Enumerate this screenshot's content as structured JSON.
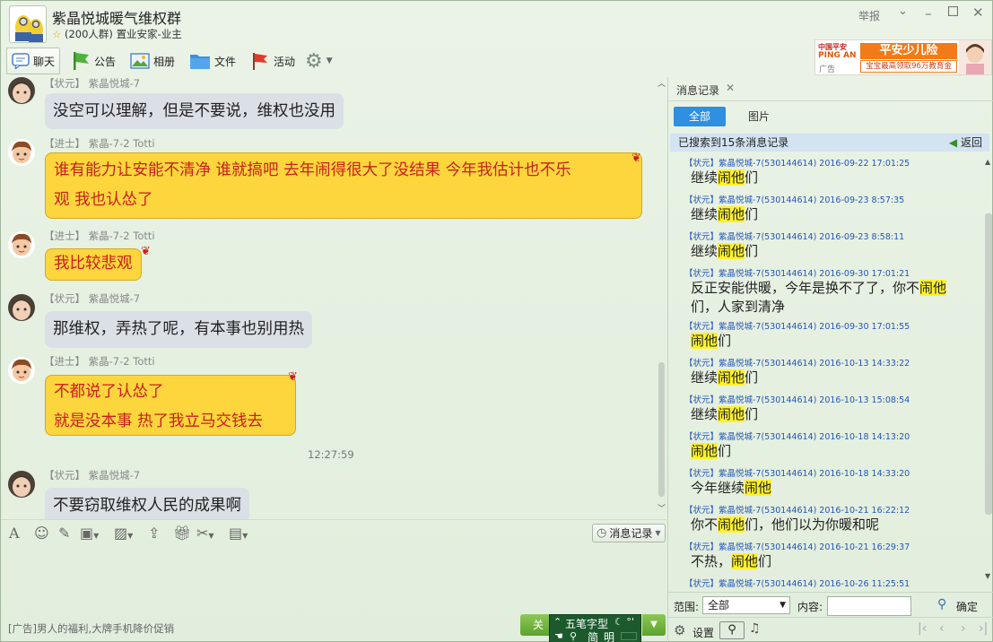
{
  "window": {
    "title": "紫晶悦城暖气维权群",
    "subtitle_count": "(200人群)",
    "subtitle_role": "置业安家-业主",
    "report": "举报"
  },
  "toolbar": {
    "chat": "聊天",
    "notice": "公告",
    "album": "相册",
    "file": "文件",
    "activity": "活动"
  },
  "ad": {
    "brand_cn": "中国平安",
    "brand_en": "PING AN",
    "ad_mark": "广告",
    "headline": "平安少儿险",
    "tagline": "宝宝最高领取96万教育金"
  },
  "messages": [
    {
      "rank": "【状元】",
      "name": "紫晶悦城-7",
      "text": "没空可以理解，但是不要说，维权也没用",
      "style": "gray"
    },
    {
      "rank": "【进士】",
      "name": "紫晶-7-2 Totti",
      "text1": "谁有能力让安能不清净 谁就搞吧  去年闹得很大了没结果 今年我估计也不乐",
      "text2": "观 我也认怂了",
      "style": "yellow"
    },
    {
      "rank": "【进士】",
      "name": "紫晶-7-2 Totti",
      "text": "我比较悲观",
      "style": "yellow"
    },
    {
      "rank": "【状元】",
      "name": "紫晶悦城-7",
      "text": "那维权，弄热了呢，有本事也别用热",
      "style": "gray"
    },
    {
      "rank": "【进士】",
      "name": "紫晶-7-2 Totti",
      "text1": "不都说了认怂了",
      "text2": "就是没本事  热了我立马交钱去",
      "style": "yellow"
    },
    {
      "rank": "【状元】",
      "name": "紫晶悦城-7",
      "text": "不要窃取维权人民的成果啊",
      "style": "gray"
    }
  ],
  "timestamp": "12:27:59",
  "input": {
    "history_label": "消息记录",
    "ad_text": "[广告]男人的福利,大牌手机降价促销",
    "close_label": "关",
    "ime_name": "五笔字型",
    "ime_mode": "简",
    "ime_mode2": "明"
  },
  "history": {
    "tab_label": "消息记录",
    "seg_all": "全部",
    "seg_pictures": "图片",
    "found_text": "已搜索到15条消息记录",
    "back_label": "返回",
    "keyword": "闹他",
    "records": [
      {
        "header": "【状元】紫晶悦城-7(530144614) 2016-09-22 17:01:25",
        "pre": "继续",
        "post": "们"
      },
      {
        "header": "【状元】紫晶悦城-7(530144614) 2016-09-23 8:57:35",
        "pre": "继续",
        "post": "们"
      },
      {
        "header": "【状元】紫晶悦城-7(530144614) 2016-09-23 8:58:11",
        "pre": "继续",
        "post": "们"
      },
      {
        "header": "【状元】紫晶悦城-7(530144614) 2016-09-30 17:01:21",
        "pre": "反正安能供暖，今年是换不了了，你不",
        "post": "们，人家到清净"
      },
      {
        "header": "【状元】紫晶悦城-7(530144614) 2016-09-30 17:01:55",
        "pre": "",
        "post": "们"
      },
      {
        "header": "【状元】紫晶悦城-7(530144614) 2016-10-13 14:33:22",
        "pre": "继续",
        "post": "们"
      },
      {
        "header": "【状元】紫晶悦城-7(530144614) 2016-10-13 15:08:54",
        "pre": "继续",
        "post": "们"
      },
      {
        "header": "【状元】紫晶悦城-7(530144614) 2016-10-18 14:13:20",
        "pre": "",
        "post": "们"
      },
      {
        "header": "【状元】紫晶悦城-7(530144614) 2016-10-18 14:33:20",
        "pre": "今年继续",
        "post": ""
      },
      {
        "header": "【状元】紫晶悦城-7(530144614) 2016-10-21 16:22:12",
        "pre": "你不",
        "post": "们，他们以为你暖和呢"
      },
      {
        "header": "【状元】紫晶悦城-7(530144614) 2016-10-21 16:29:37",
        "pre": "不热，",
        "post": "们"
      },
      {
        "header": "【状元】紫晶悦城-7(530144614) 2016-10-26 11:25:51",
        "pre": "",
        "post": ""
      }
    ],
    "range_label": "范围:",
    "range_value": "全部",
    "content_label": "内容:",
    "confirm_label": "确定",
    "settings_label": "设置"
  }
}
